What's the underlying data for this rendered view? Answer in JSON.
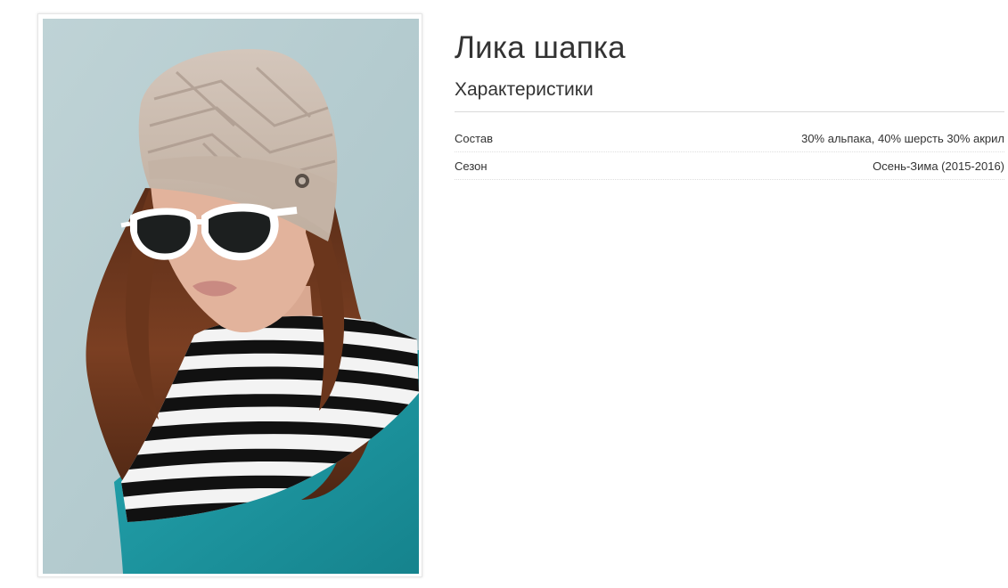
{
  "product": {
    "title": "Лика шапка",
    "characteristics_heading": "Характеристики",
    "image_alt": "Лика шапка",
    "specs": [
      {
        "label": "Состав",
        "value": "30% альпака, 40% шерсть 30% акрил"
      },
      {
        "label": "Сезон",
        "value": "Осень-Зима (2015-2016)"
      }
    ]
  },
  "colors": {
    "background": "#ffffff",
    "text": "#333333",
    "photo_backdrop": "#b6cdd1",
    "hat": "#c9b9ae",
    "sweater": "#1c9aa4"
  }
}
